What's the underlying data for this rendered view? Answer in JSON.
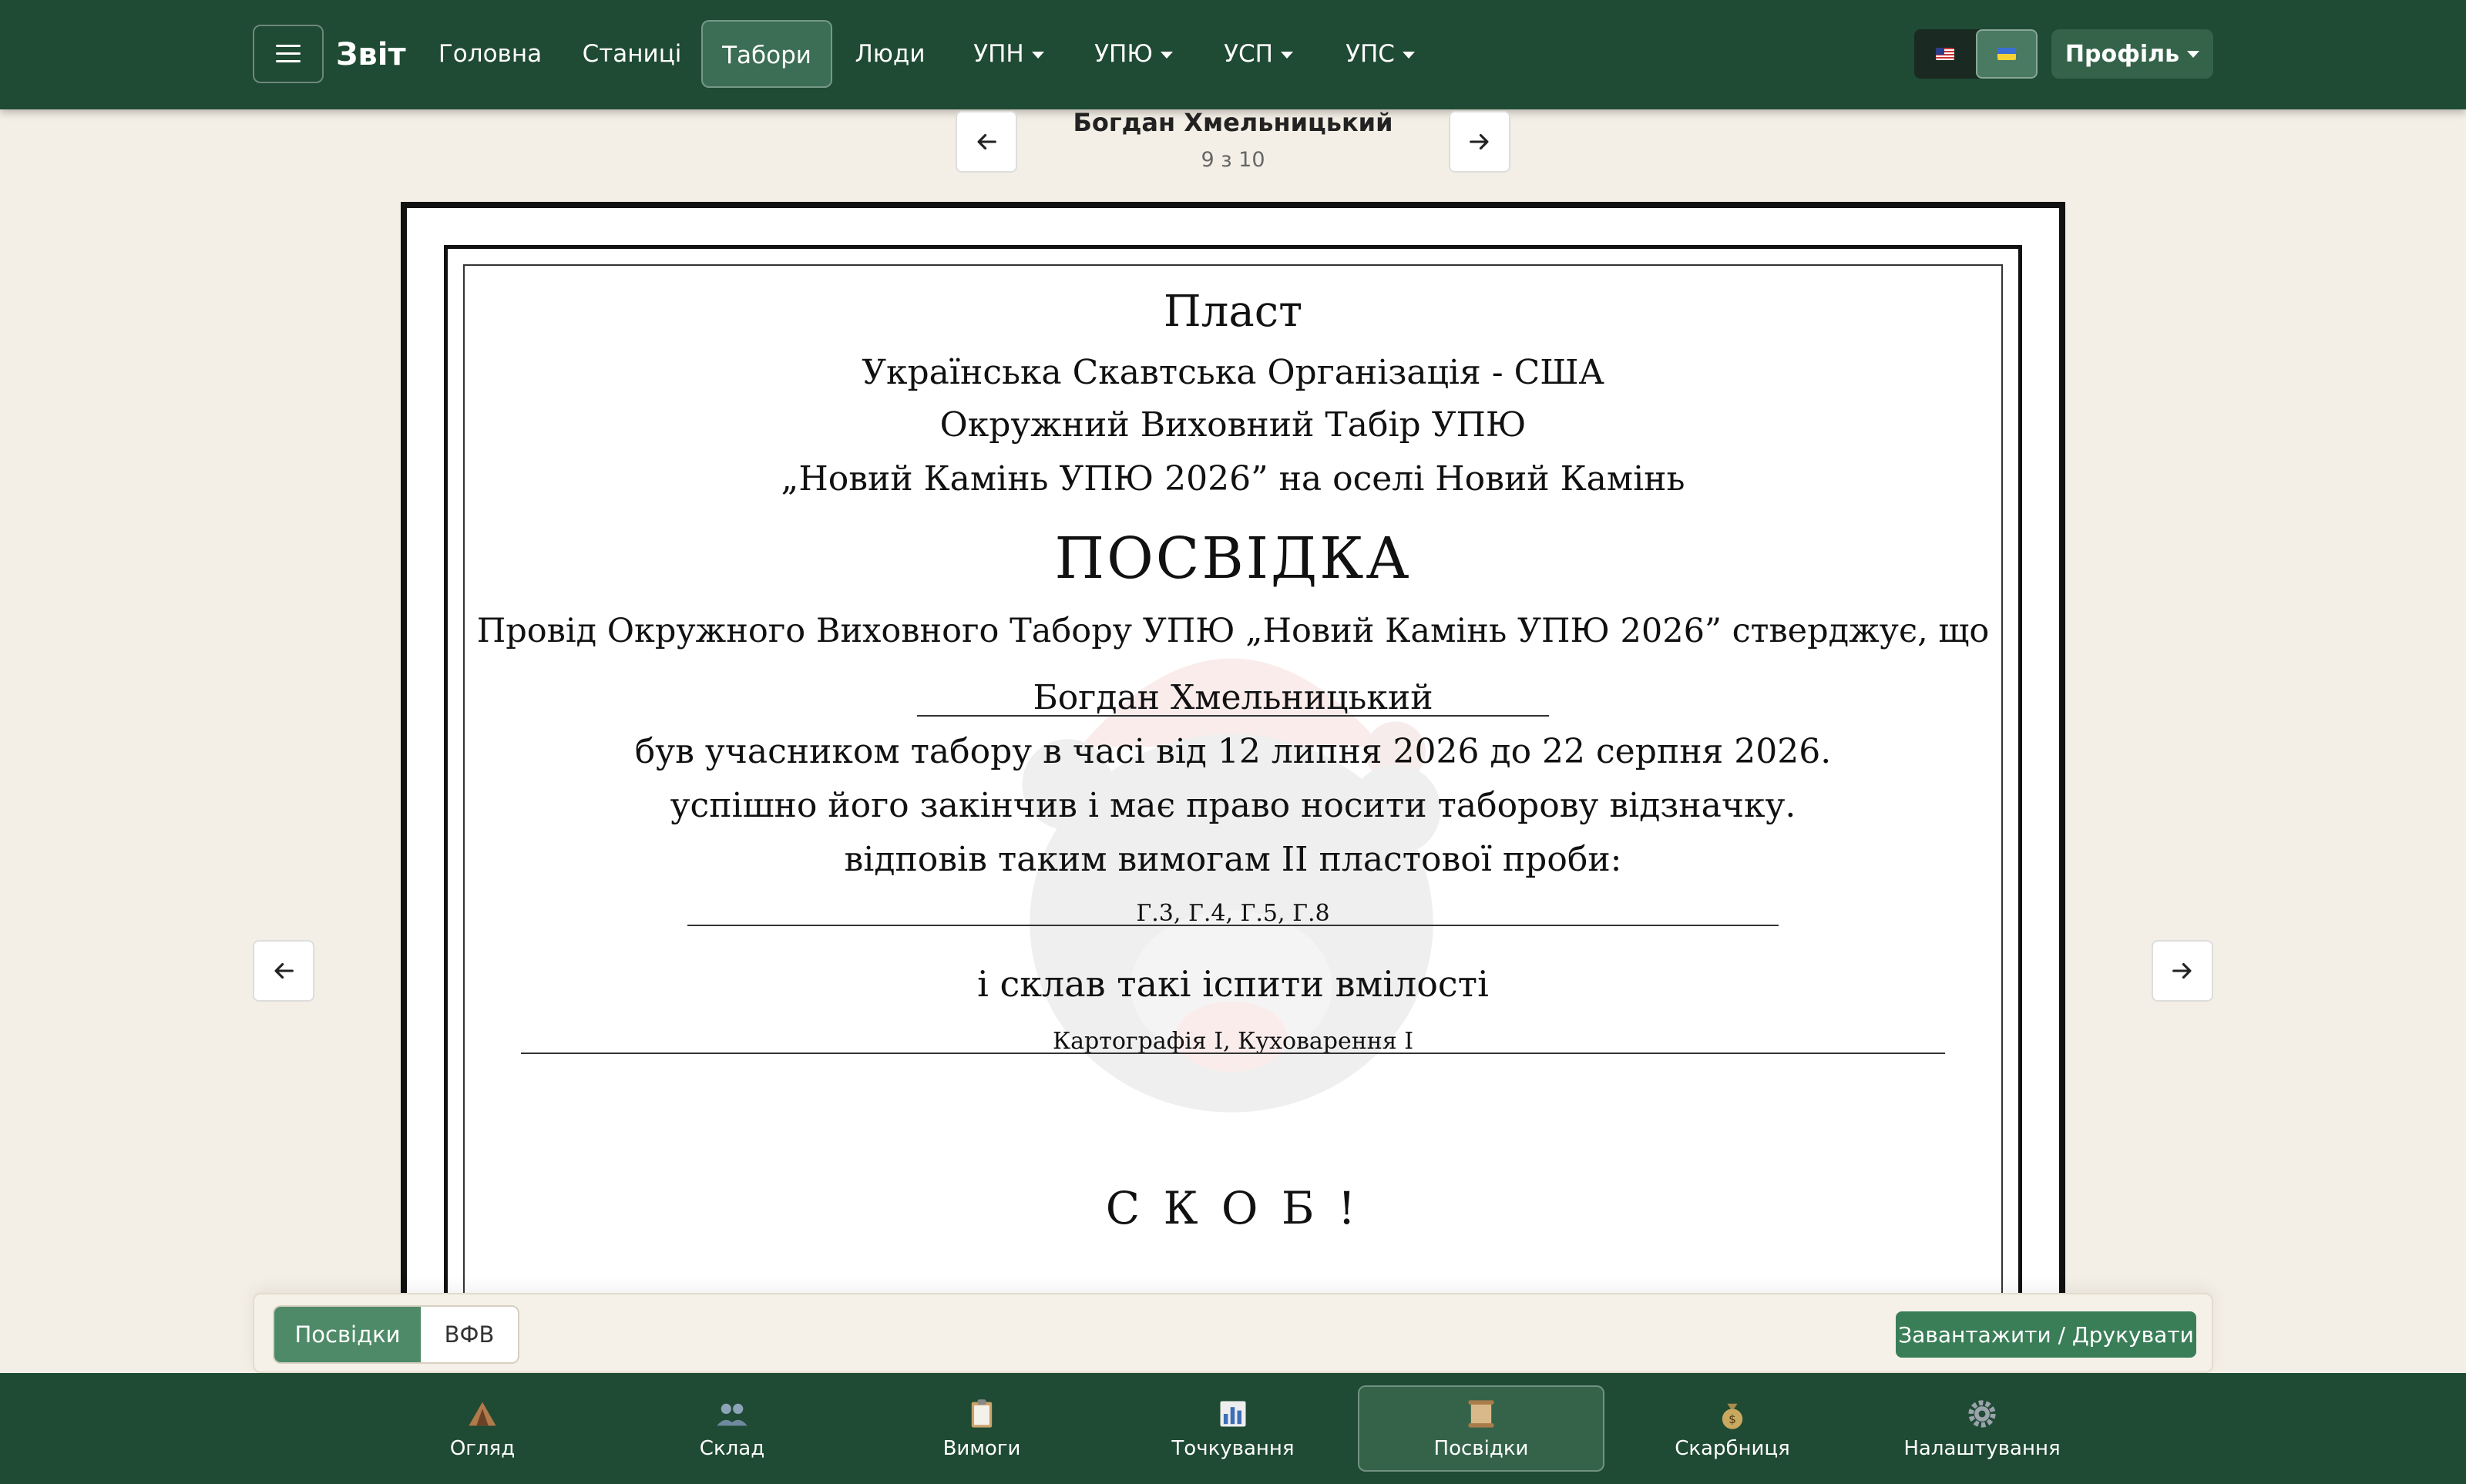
{
  "header": {
    "brand": "Звіт",
    "nav": [
      {
        "label": "Головна"
      },
      {
        "label": "Станиці"
      },
      {
        "label": "Табори",
        "active": true
      },
      {
        "label": "Люди"
      },
      {
        "label": "УПН",
        "dropdown": true
      },
      {
        "label": "УПЮ",
        "dropdown": true
      },
      {
        "label": "УСП",
        "dropdown": true
      },
      {
        "label": "УПС",
        "dropdown": true
      }
    ],
    "languages": [
      {
        "icon": "us-flag-icon"
      },
      {
        "icon": "ua-flag-icon",
        "active": true
      }
    ],
    "profile_label": "Профіль"
  },
  "pager": {
    "name": "Богдан Хмельницький",
    "count": "9 з 10"
  },
  "certificate": {
    "org": "Пласт",
    "org_full": "Українська Скавтська Організація - США",
    "camp_type": "Окружний Виховний Табір УПЮ",
    "camp_name": "„Новий Камінь УПЮ 2026” на оселі Новий Камінь",
    "doc_title": "ПОСВІДКА",
    "statement": "Провід Окружного Виховного Табору УПЮ „Новий Камінь УПЮ 2026” стверджує, що",
    "participant": "Богдан Хмельницький",
    "dates_line": "був учасником табору в часі від 12 липня 2026 до 22 серпня 2026.",
    "completed_line": "успішно його закінчив і має право носити таборову відзначку.",
    "requirements_line": "відповів таким вимогам II пластової проби:",
    "requirements_value": "Г.3, Г.4, Г.5, Г.8",
    "skills_line": "і склав такі іспити вмілості",
    "skills_value": "Картографія I, Куховарення I",
    "motto": "С К О Б !"
  },
  "toolbar": {
    "tabs": [
      {
        "label": "Посвідки",
        "active": true
      },
      {
        "label": "ВФВ"
      }
    ],
    "download_label": "Завантажити / Друкувати"
  },
  "bottom_nav": [
    {
      "label": "Огляд",
      "icon": "tent-icon"
    },
    {
      "label": "Склад",
      "icon": "people-icon"
    },
    {
      "label": "Вимоги",
      "icon": "clipboard-icon"
    },
    {
      "label": "Точкування",
      "icon": "bar-chart-icon"
    },
    {
      "label": "Посвідки",
      "icon": "scroll-icon",
      "active": true
    },
    {
      "label": "Скарбниця",
      "icon": "money-bag-icon"
    },
    {
      "label": "Налаштування",
      "icon": "gear-icon"
    }
  ],
  "colors": {
    "header_bg": "#1f4a33",
    "accent": "#4e8a68",
    "page_bg": "#f3efe6"
  }
}
